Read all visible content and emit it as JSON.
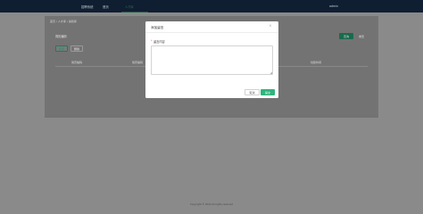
{
  "header": {
    "brand": "招聘系统",
    "home": "首页",
    "active_tab": "人才库",
    "user": "admin"
  },
  "page": {
    "breadcrumb": "首页 / 人才库 / 编辑库",
    "filter_label": "简历编码",
    "button_add": "新增",
    "button_delete": "删除",
    "button_query": "查询",
    "button_reset": "重置",
    "columns": [
      "简历编码",
      "简历编码",
      "创建时间"
    ]
  },
  "modal": {
    "title": "添加留言",
    "required_mark": "*",
    "field_label": "留言内容",
    "textarea_value": "",
    "cancel": "取消",
    "confirm": "提交"
  },
  "footer": {
    "copyright": "Copyright © 2024 All rights reserved"
  }
}
